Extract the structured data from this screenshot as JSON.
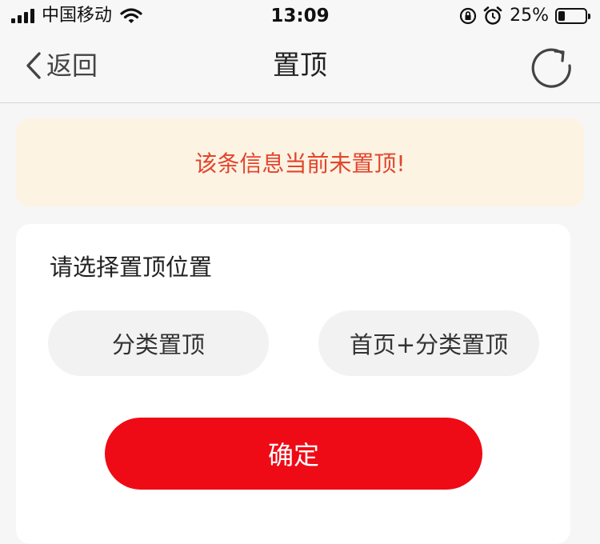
{
  "status_bar": {
    "carrier": "中国移动",
    "time": "13:09",
    "battery_percent": "25%",
    "battery_level": 0.25
  },
  "nav": {
    "back_label": "返回",
    "title": "置顶",
    "refresh_icon": "refresh-icon"
  },
  "notice": {
    "message": "该条信息当前未置顶!",
    "color": "#e2452c",
    "background": "#fcf3e3"
  },
  "card": {
    "title": "请选择置顶位置",
    "options": [
      {
        "label": "分类置顶"
      },
      {
        "label": "首页+分类置顶"
      }
    ],
    "confirm_label": "确定",
    "confirm_color": "#ee0b16"
  }
}
